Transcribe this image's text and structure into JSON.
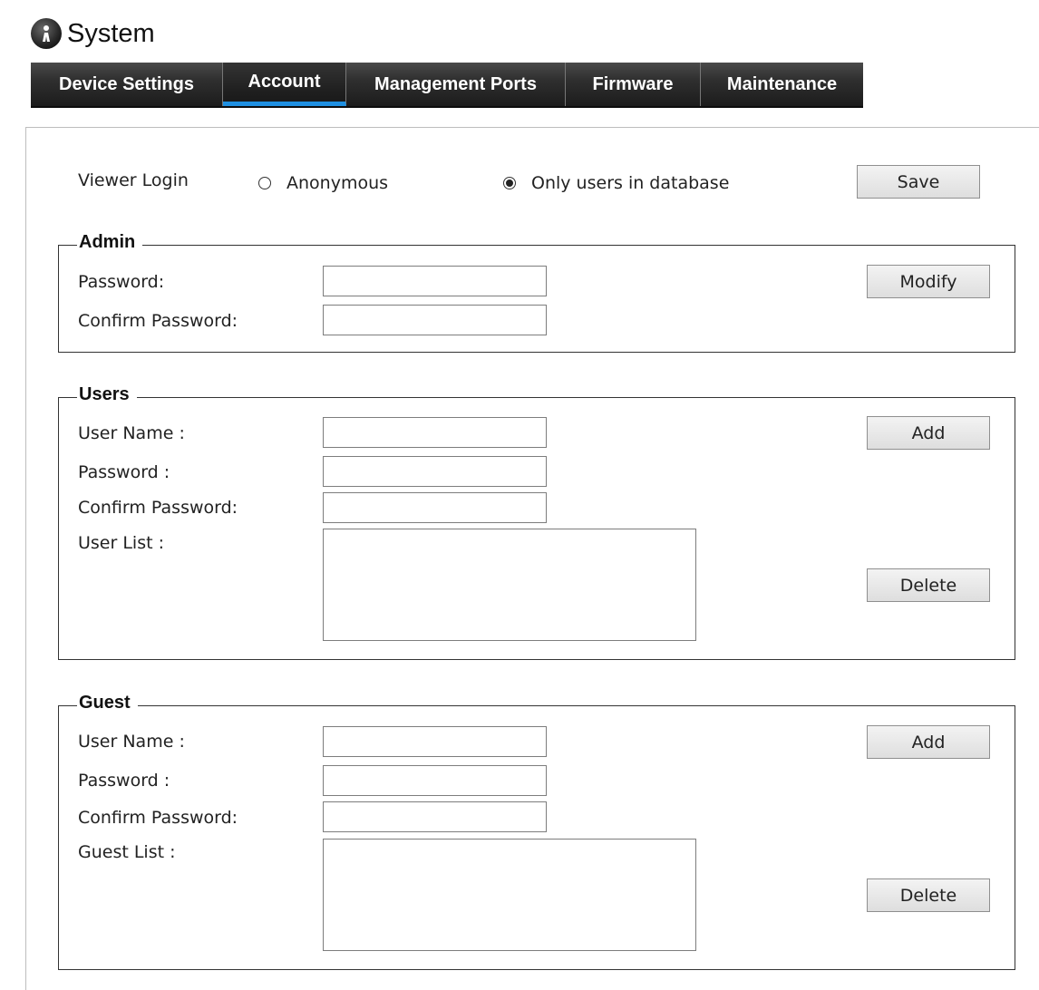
{
  "header": {
    "title": "System",
    "logo_icon": "camera-logo-icon"
  },
  "tabs": [
    {
      "label": "Device Settings",
      "active": false
    },
    {
      "label": "Account",
      "active": true
    },
    {
      "label": "Management Ports",
      "active": false
    },
    {
      "label": "Firmware",
      "active": false
    },
    {
      "label": "Maintenance",
      "active": false
    }
  ],
  "viewer_login": {
    "label": "Viewer Login",
    "options": [
      {
        "label": "Anonymous",
        "selected": false
      },
      {
        "label": "Only users in database",
        "selected": true
      }
    ],
    "save_label": "Save"
  },
  "admin": {
    "legend": "Admin",
    "password_label": "Password:",
    "password_value": "",
    "confirm_label": "Confirm Password:",
    "confirm_value": "",
    "modify_label": "Modify"
  },
  "users": {
    "legend": "Users",
    "username_label": "User Name :",
    "username_value": "",
    "password_label": "Password :",
    "password_value": "",
    "confirm_label": "Confirm Password:",
    "confirm_value": "",
    "list_label": "User List :",
    "list_items": [],
    "add_label": "Add",
    "delete_label": "Delete"
  },
  "guest": {
    "legend": "Guest",
    "username_label": "User Name :",
    "username_value": "",
    "password_label": "Password :",
    "password_value": "",
    "confirm_label": "Confirm Password:",
    "confirm_value": "",
    "list_label": "Guest List :",
    "list_items": [],
    "add_label": "Add",
    "delete_label": "Delete"
  },
  "colors": {
    "tab_active_underline": "#1e8fe1",
    "tab_bar": "#2f2f2f"
  }
}
